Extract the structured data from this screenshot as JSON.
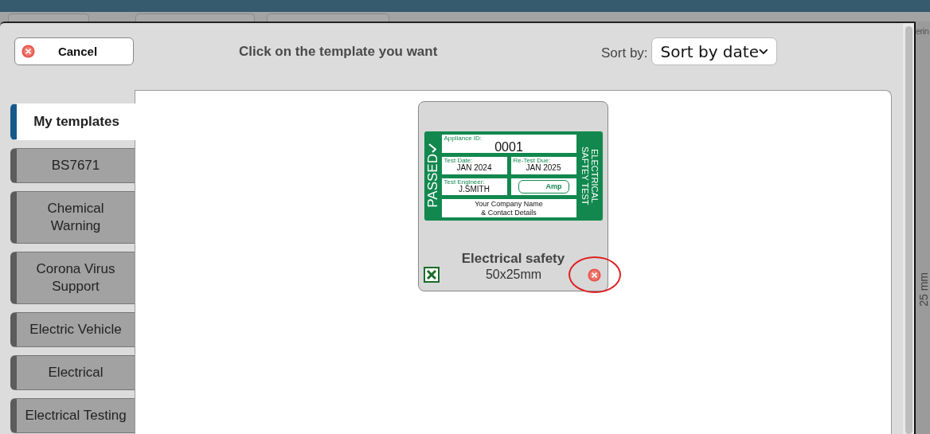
{
  "background": {
    "side_text": "erin",
    "ruler_label": "25 mm"
  },
  "dialog": {
    "cancel_button": "Cancel",
    "heading": "Click on the template you want",
    "sort": {
      "label": "Sort by:",
      "value": "Sort by date"
    },
    "categories": [
      {
        "label": "My templates",
        "selected": true
      },
      {
        "label": "BS7671",
        "selected": false
      },
      {
        "label": "Chemical Warning",
        "selected": false
      },
      {
        "label": "Corona Virus Support",
        "selected": false
      },
      {
        "label": "Electric Vehicle",
        "selected": false
      },
      {
        "label": "Electrical",
        "selected": false
      },
      {
        "label": "Electrical Testing",
        "selected": false
      }
    ],
    "templates": [
      {
        "name": "Electrical safety",
        "size": "50x25mm",
        "delete_highlighted": true,
        "label": {
          "status": "PASSED",
          "side_title": [
            "ELECTRICAL",
            "SAFTEY TEST"
          ],
          "appliance": {
            "caption": "Appliance ID:",
            "value": "0001"
          },
          "dates": [
            {
              "caption": "Test Date:",
              "value": "JAN 2024"
            },
            {
              "caption": "Re-Test Due:",
              "value": "JAN 2025"
            }
          ],
          "engineer": {
            "caption": "Test Engineer:",
            "value": "J.SMITH"
          },
          "fuse_text": "Amp",
          "company": [
            "Your Company Name",
            "& Contact Details"
          ]
        }
      }
    ]
  }
}
